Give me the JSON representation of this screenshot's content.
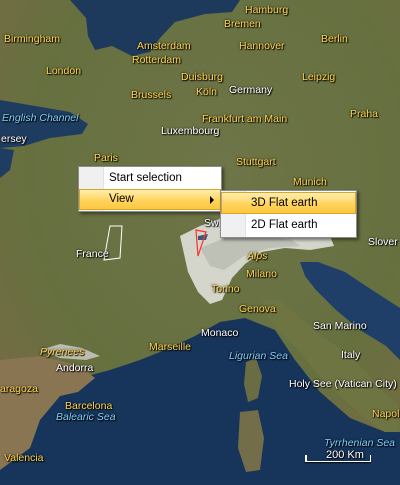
{
  "map": {
    "labels": [
      {
        "id": "hamburg",
        "text": "Hamburg",
        "kind": "cap"
      },
      {
        "id": "bremen",
        "text": "Bremen",
        "kind": "cap"
      },
      {
        "id": "birmingham",
        "text": "Birmingham",
        "kind": "cap"
      },
      {
        "id": "amsterdam",
        "text": "Amsterdam",
        "kind": "cap"
      },
      {
        "id": "hannover",
        "text": "Hannover",
        "kind": "cap"
      },
      {
        "id": "berlin",
        "text": "Berlin",
        "kind": "cap"
      },
      {
        "id": "rotterdam",
        "text": "Rotterdam",
        "kind": "cap"
      },
      {
        "id": "london",
        "text": "London",
        "kind": "cap"
      },
      {
        "id": "duisburg",
        "text": "Duisburg",
        "kind": "cap"
      },
      {
        "id": "leipzig",
        "text": "Leipzig",
        "kind": "cap"
      },
      {
        "id": "brussels",
        "text": "Brussels",
        "kind": "cap"
      },
      {
        "id": "koln",
        "text": "Köln",
        "kind": "cap"
      },
      {
        "id": "germany",
        "text": "Germany",
        "kind": "city"
      },
      {
        "id": "english-channel",
        "text": "English Channel",
        "kind": "sea"
      },
      {
        "id": "frankfurt",
        "text": "Frankfurt am Main",
        "kind": "cap"
      },
      {
        "id": "praha",
        "text": "Praha",
        "kind": "cap"
      },
      {
        "id": "jersey",
        "text": "ersey",
        "kind": "city"
      },
      {
        "id": "luxembourg",
        "text": "Luxembourg",
        "kind": "city"
      },
      {
        "id": "paris",
        "text": "Paris",
        "kind": "cap"
      },
      {
        "id": "stuttgart",
        "text": "Stuttgart",
        "kind": "cap"
      },
      {
        "id": "munich",
        "text": "Munich",
        "kind": "cap"
      },
      {
        "id": "swiss",
        "text": "Swi",
        "kind": "city"
      },
      {
        "id": "france",
        "text": "France",
        "kind": "city"
      },
      {
        "id": "alps",
        "text": "Alps",
        "kind": "mtn"
      },
      {
        "id": "slovenia",
        "text": "Slover",
        "kind": "city"
      },
      {
        "id": "milano",
        "text": "Milano",
        "kind": "cap"
      },
      {
        "id": "torino",
        "text": "Torino",
        "kind": "cap"
      },
      {
        "id": "genova",
        "text": "Genova",
        "kind": "cap"
      },
      {
        "id": "monaco",
        "text": "Monaco",
        "kind": "city"
      },
      {
        "id": "san-marino",
        "text": "San Marino",
        "kind": "city"
      },
      {
        "id": "pyrenees",
        "text": "Pyrenees",
        "kind": "mtn"
      },
      {
        "id": "marseille",
        "text": "Marseille",
        "kind": "cap"
      },
      {
        "id": "andorra",
        "text": "Andorra",
        "kind": "city"
      },
      {
        "id": "ligurian-sea",
        "text": "Ligurian Sea",
        "kind": "sea"
      },
      {
        "id": "italy",
        "text": "Italy",
        "kind": "city"
      },
      {
        "id": "zaragoza",
        "text": "aragoza",
        "kind": "cap"
      },
      {
        "id": "holy-see",
        "text": "Holy See (Vatican City)",
        "kind": "city"
      },
      {
        "id": "barcelona",
        "text": "Barcelona",
        "kind": "cap"
      },
      {
        "id": "balearic-sea",
        "text": "Balearic Sea",
        "kind": "sea"
      },
      {
        "id": "napoli",
        "text": "Napol",
        "kind": "cap"
      },
      {
        "id": "tyrrhenian-sea",
        "text": "Tyrrhenian Sea",
        "kind": "sea"
      },
      {
        "id": "valencia",
        "text": "Valencia",
        "kind": "cap"
      }
    ],
    "scale": {
      "label": "200 Km"
    }
  },
  "context_menu": {
    "items": [
      {
        "label": "Start selection",
        "has_submenu": false
      },
      {
        "label": "View",
        "has_submenu": true,
        "highlighted": true
      }
    ]
  },
  "submenu": {
    "items": [
      {
        "label": "3D Flat earth",
        "highlighted": true
      },
      {
        "label": "2D Flat earth",
        "highlighted": false
      }
    ]
  },
  "colors": {
    "menu_highlight": "#ffd35c",
    "city_label": "#ffd34d",
    "sea_label": "#7fd0ff"
  }
}
